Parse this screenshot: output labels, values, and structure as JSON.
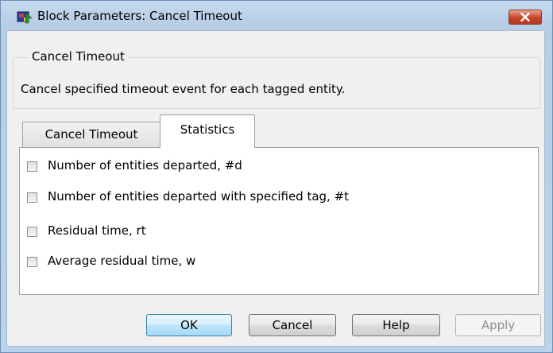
{
  "window": {
    "title": "Block Parameters: Cancel Timeout",
    "icon": "simulink-block-icon",
    "close_icon": "close-icon"
  },
  "group": {
    "legend": "Cancel Timeout",
    "description": "Cancel specified timeout event for each tagged entity."
  },
  "tabs": [
    {
      "label": "Cancel Timeout",
      "active": false
    },
    {
      "label": "Statistics",
      "active": true
    }
  ],
  "statistics": [
    {
      "label": "Number of entities departed, #d",
      "checked": false
    },
    {
      "label": "Number of entities departed with specified tag, #t",
      "checked": false
    },
    {
      "label": "Residual time, rt",
      "checked": false
    },
    {
      "label": "Average residual time, w",
      "checked": false
    }
  ],
  "buttons": {
    "ok": "OK",
    "cancel": "Cancel",
    "help": "Help",
    "apply": "Apply",
    "apply_enabled": false
  }
}
